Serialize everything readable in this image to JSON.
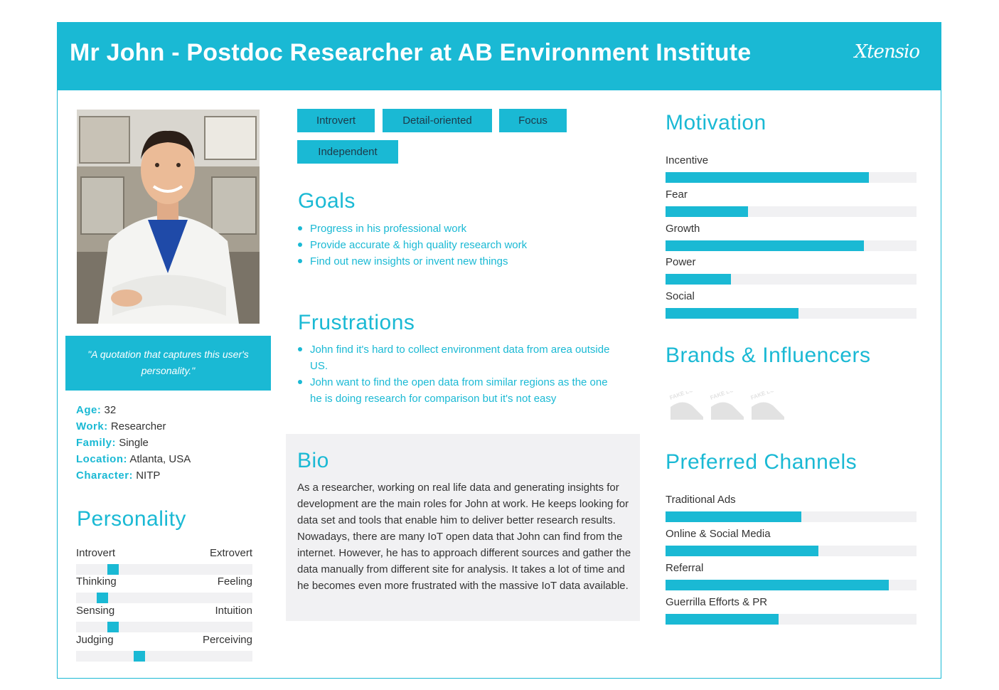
{
  "header": {
    "title": "Mr John - Postdoc Researcher at AB Environment Institute",
    "logo": "Xtensio"
  },
  "quote": "\"A quotation that captures this user's personality.\"",
  "facts": [
    {
      "key": "Age:",
      "value": "32"
    },
    {
      "key": "Work:",
      "value": "Researcher"
    },
    {
      "key": "Family:",
      "value": "Single"
    },
    {
      "key": "Location:",
      "value": "Atlanta, USA"
    },
    {
      "key": "Character:",
      "value": "NITP"
    }
  ],
  "personality": {
    "title": "Personality",
    "scales": [
      {
        "left": "Introvert",
        "right": "Extrovert",
        "level": 0.21
      },
      {
        "left": "Thinking",
        "right": "Feeling",
        "level": 0.15
      },
      {
        "left": "Sensing",
        "right": "Intuition",
        "level": 0.21
      },
      {
        "left": "Judging",
        "right": "Perceiving",
        "level": 0.36
      }
    ]
  },
  "tags": [
    "Introvert",
    "Detail-oriented",
    "Focus",
    "Independent"
  ],
  "goals": {
    "title": "Goals",
    "items": [
      "Progress in his professional work",
      "Provide accurate & high quality research work",
      "Find out new insights or invent new things"
    ]
  },
  "frustrations": {
    "title": "Frustrations",
    "items": [
      "John find it's hard to collect environment data from area outside US.",
      "John want to find the open data from similar regions as the one he is doing research for comparison but it's not easy"
    ]
  },
  "bio": {
    "title": "Bio",
    "text": "As a researcher, working on real life data and generating insights for development are the main roles for John at work. He keeps looking for data set and tools that enable him to deliver better research results. Nowadays, there are many IoT open data that John can find from the internet. However, he has to approach different sources and gather the data manually from different site for analysis. It takes a lot of time and he becomes even more frustrated with the massive IoT data available."
  },
  "motivation": {
    "title": "Motivation",
    "items": [
      {
        "label": "Incentive",
        "level": 0.81
      },
      {
        "label": "Fear",
        "level": 0.33
      },
      {
        "label": "Growth",
        "level": 0.79
      },
      {
        "label": "Power",
        "level": 0.26
      },
      {
        "label": "Social",
        "level": 0.53
      }
    ]
  },
  "brands": {
    "title": "Brands & Influencers",
    "logo_text": [
      "FAKE LOGO",
      "FAKE LOGO",
      "FAKE LOGO"
    ]
  },
  "channels": {
    "title": "Preferred Channels",
    "items": [
      {
        "label": "Traditional Ads",
        "level": 0.54
      },
      {
        "label": "Online & Social Media",
        "level": 0.61
      },
      {
        "label": "Referral",
        "level": 0.89
      },
      {
        "label": "Guerrilla Efforts & PR",
        "level": 0.45
      }
    ]
  },
  "colors": {
    "accent": "#1ab9d4",
    "track": "#f1f1f3",
    "bio_bg": "#f1f1f3"
  }
}
